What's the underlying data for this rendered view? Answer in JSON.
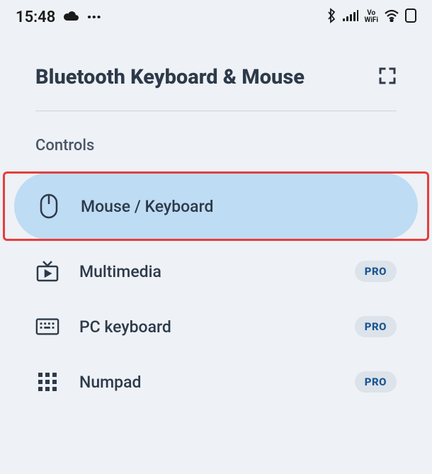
{
  "statusbar": {
    "time": "15:48"
  },
  "header": {
    "title": "Bluetooth Keyboard & Mouse"
  },
  "section": {
    "label": "Controls"
  },
  "items": [
    {
      "label": "Mouse / Keyboard",
      "badge": null
    },
    {
      "label": "Multimedia",
      "badge": "PRO"
    },
    {
      "label": "PC keyboard",
      "badge": "PRO"
    },
    {
      "label": "Numpad",
      "badge": "PRO"
    }
  ]
}
